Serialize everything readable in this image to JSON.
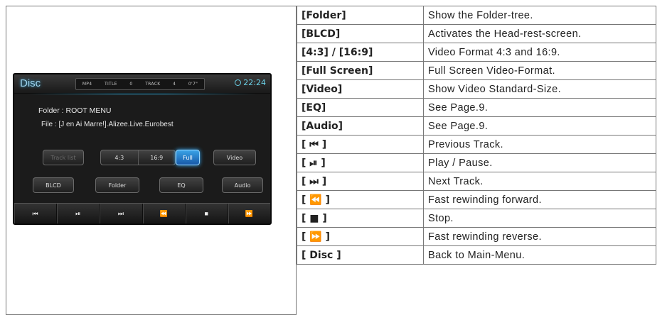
{
  "device": {
    "title": "Disc",
    "info": {
      "format": "MP4",
      "title_label": "TITLE",
      "title_num": "0",
      "track_label": "TRACK",
      "track_num": "4",
      "time": "0'7\""
    },
    "clock": "22:24",
    "folder_line": "Folder : ROOT MENU",
    "file_line": "File : [J en Ai Marre!].Alizee.Live.Eurobest",
    "buttons_row1": {
      "track_list": "Track list",
      "ratio_43": "4:3",
      "ratio_169": "16:9",
      "full": "Full",
      "video": "Video"
    },
    "buttons_row2": {
      "blcd": "BLCD",
      "folder": "Folder",
      "eq": "EQ",
      "audio": "Audio"
    },
    "transport": [
      "⏮",
      "⏯",
      "⏭",
      "⏪",
      "■",
      "⏩"
    ]
  },
  "table": {
    "rows": [
      {
        "key": "[Folder]",
        "desc": "Show the Folder-tree."
      },
      {
        "key": "[BLCD]",
        "desc": "Activates the Head-rest-screen."
      },
      {
        "key": "[4:3] / [16:9]",
        "desc": "Video Format 4:3 and 16:9."
      },
      {
        "key": "[Full Screen]",
        "desc": "Full Screen Video-Format."
      },
      {
        "key": "[Video]",
        "desc": "Show Video Standard-Size."
      },
      {
        "key": "[EQ]",
        "desc": "See Page.9."
      },
      {
        "key": "[Audio]",
        "desc": "See Page.9."
      },
      {
        "key": "[ ⏮ ]",
        "desc": "Previous Track."
      },
      {
        "key": "[ ⏯ ]",
        "desc": "Play / Pause."
      },
      {
        "key": "[ ⏭ ]",
        "desc": "Next Track."
      },
      {
        "key": "[ ⏪ ]",
        "desc": "Fast rewinding forward."
      },
      {
        "key": "[ ■ ]",
        "desc": "Stop."
      },
      {
        "key": "[ ⏩ ]",
        "desc": "Fast rewinding reverse."
      },
      {
        "key": "[ Disc ]",
        "desc": "Back to Main-Menu."
      }
    ]
  }
}
